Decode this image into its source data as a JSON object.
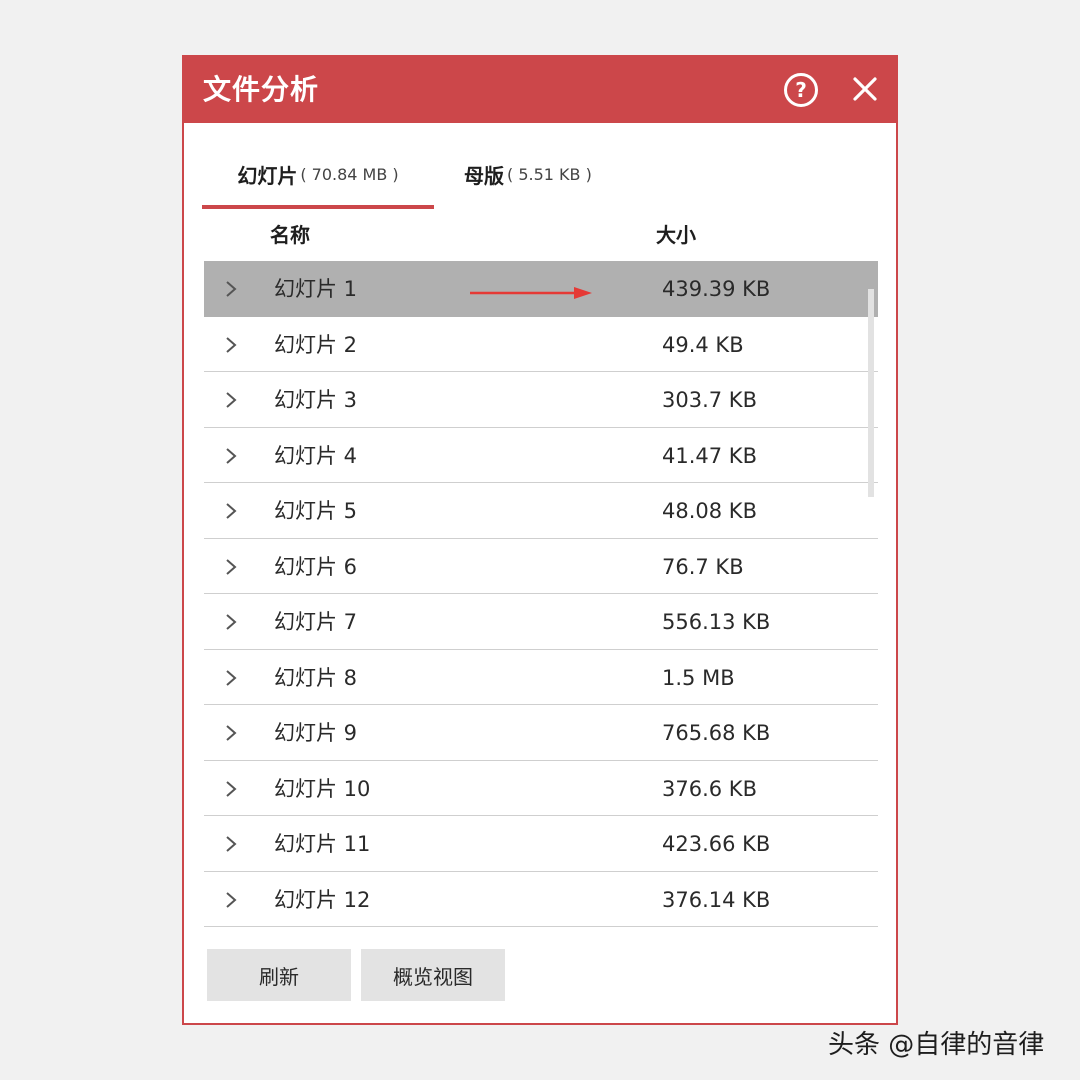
{
  "dialog": {
    "title": "文件分析",
    "help_icon_glyph": "?",
    "tabs": [
      {
        "label": "幻灯片",
        "size": "( 70.84 MB )",
        "active": true
      },
      {
        "label": "母版",
        "size": "( 5.51 KB )",
        "active": false
      }
    ],
    "columns": {
      "name": "名称",
      "size": "大小"
    },
    "rows": [
      {
        "name": "幻灯片 1",
        "size": "439.39 KB",
        "selected": true
      },
      {
        "name": "幻灯片 2",
        "size": "49.4 KB"
      },
      {
        "name": "幻灯片 3",
        "size": "303.7 KB"
      },
      {
        "name": "幻灯片 4",
        "size": "41.47 KB"
      },
      {
        "name": "幻灯片 5",
        "size": "48.08 KB"
      },
      {
        "name": "幻灯片 6",
        "size": "76.7 KB"
      },
      {
        "name": "幻灯片 7",
        "size": "556.13 KB"
      },
      {
        "name": "幻灯片 8",
        "size": "1.5 MB"
      },
      {
        "name": "幻灯片 9",
        "size": "765.68 KB"
      },
      {
        "name": "幻灯片 10",
        "size": "376.6 KB"
      },
      {
        "name": "幻灯片 11",
        "size": "423.66 KB"
      },
      {
        "name": "幻灯片 12",
        "size": "376.14 KB"
      }
    ],
    "buttons": {
      "refresh": "刷新",
      "overview": "概览视图"
    }
  },
  "watermark": "头条 @自律的音律",
  "colors": {
    "accent": "#cc474a",
    "selected_row": "#b0b0b0",
    "annotation_arrow": "#e53935"
  }
}
